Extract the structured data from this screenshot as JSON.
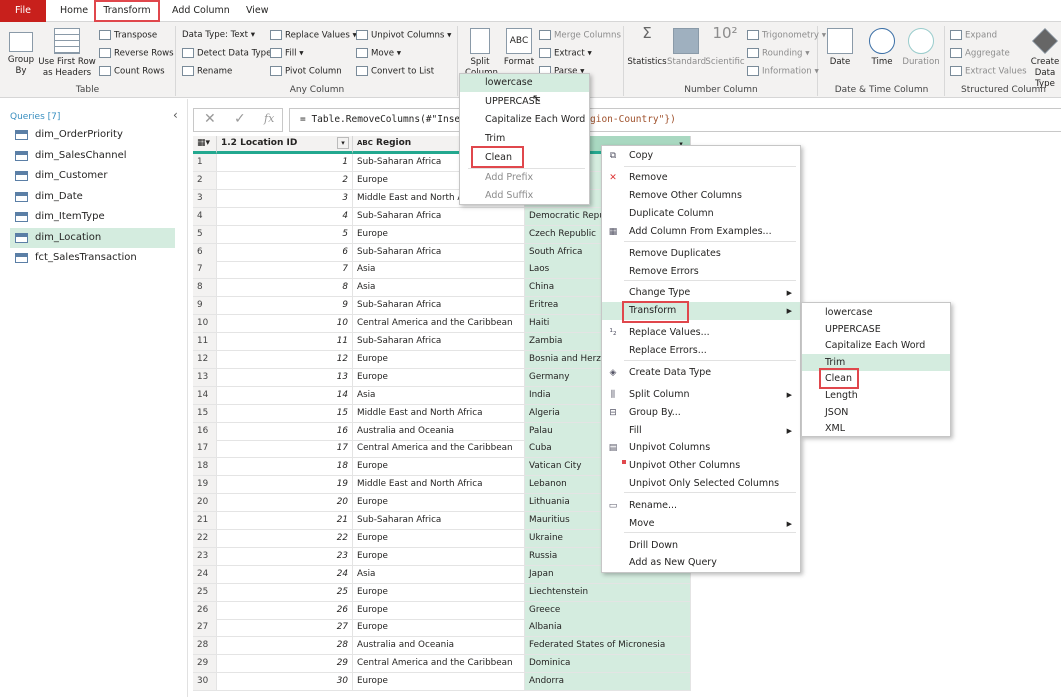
{
  "tabs": [
    "File",
    "Home",
    "Transform",
    "Add Column",
    "View"
  ],
  "ribbon": {
    "table": {
      "label": "Table",
      "group_by": "Group By",
      "first_row": "Use First Row as Headers",
      "transpose": "Transpose",
      "reverse": "Reverse Rows",
      "count": "Count Rows"
    },
    "any": {
      "label": "Any Column",
      "data_type": "Data Type: Text",
      "detect": "Detect Data Type",
      "rename": "Rename",
      "replace": "Replace Values",
      "fill": "Fill",
      "pivot": "Pivot Column",
      "unpivot": "Unpivot Columns",
      "move": "Move",
      "convert": "Convert to List"
    },
    "text": {
      "split": "Split Column",
      "format": "Format",
      "merge": "Merge Columns",
      "extract": "Extract",
      "parse": "Parse"
    },
    "number": {
      "label": "Number Column",
      "statistics": "Statistics",
      "standard": "Standard",
      "scientific": "Scientific",
      "trig": "Trigonometry",
      "rounding": "Rounding",
      "information": "Information"
    },
    "datetime": {
      "label": "Date & Time Column",
      "date": "Date",
      "time": "Time",
      "duration": "Duration"
    },
    "structured": {
      "label": "Structured Column",
      "expand": "Expand",
      "aggregate": "Aggregate",
      "extract_values": "Extract Values",
      "create": "Create Data Type"
    }
  },
  "queries": {
    "header": "Queries [7]",
    "items": [
      "dim_OrderPriority",
      "dim_SalesChannel",
      "dim_Customer",
      "dim_Date",
      "dim_ItemType",
      "dim_Location",
      "fct_SalesTransaction"
    ],
    "selected": "dim_Location"
  },
  "formula": {
    "text": "= Table.RemoveColumns(#\"Inser",
    "tail": "gion-Country\"})"
  },
  "columns": [
    {
      "type": "1.2",
      "name": "Location ID"
    },
    {
      "type": "ABC",
      "name": "Region"
    }
  ],
  "rows": [
    [
      1,
      "Sub-Saharan Africa",
      ""
    ],
    [
      2,
      "Europe",
      ""
    ],
    [
      3,
      "Middle East and North Africa",
      ""
    ],
    [
      4,
      "Sub-Saharan Africa",
      "Democratic Republic of the Congo"
    ],
    [
      5,
      "Europe",
      "Czech Republic"
    ],
    [
      6,
      "Sub-Saharan Africa",
      "South Africa"
    ],
    [
      7,
      "Asia",
      "Laos"
    ],
    [
      8,
      "Asia",
      "China"
    ],
    [
      9,
      "Sub-Saharan Africa",
      "Eritrea"
    ],
    [
      10,
      "Central America and the Caribbean",
      "Haiti"
    ],
    [
      11,
      "Sub-Saharan Africa",
      "Zambia"
    ],
    [
      12,
      "Europe",
      "Bosnia and Herzegovina"
    ],
    [
      13,
      "Europe",
      "Germany"
    ],
    [
      14,
      "Asia",
      "India"
    ],
    [
      15,
      "Middle East and North Africa",
      "Algeria"
    ],
    [
      16,
      "Australia and Oceania",
      "Palau"
    ],
    [
      17,
      "Central America and the Caribbean",
      "Cuba"
    ],
    [
      18,
      "Europe",
      "Vatican City"
    ],
    [
      19,
      "Middle East and North Africa",
      "Lebanon"
    ],
    [
      20,
      "Europe",
      "Lithuania"
    ],
    [
      21,
      "Sub-Saharan Africa",
      "Mauritius"
    ],
    [
      22,
      "Europe",
      "Ukraine"
    ],
    [
      23,
      "Europe",
      "Russia"
    ],
    [
      24,
      "Asia",
      "Japan"
    ],
    [
      25,
      "Europe",
      "Liechtenstein"
    ],
    [
      26,
      "Europe",
      "Greece"
    ],
    [
      27,
      "Europe",
      "Albania"
    ],
    [
      28,
      "Australia and Oceania",
      "Federated States of Micronesia"
    ],
    [
      29,
      "Central America and the Caribbean",
      "Dominica"
    ],
    [
      30,
      "Europe",
      "Andorra"
    ]
  ],
  "format_menu": [
    "lowercase",
    "UPPERCASE",
    "Capitalize Each Word",
    "Trim",
    "Clean",
    "Add Prefix",
    "Add Suffix"
  ],
  "context_menu": [
    "Copy",
    "Remove",
    "Remove Other Columns",
    "Duplicate Column",
    "Add Column From Examples...",
    "Remove Duplicates",
    "Remove Errors",
    "Change Type",
    "Transform",
    "Replace Values...",
    "Replace Errors...",
    "Create Data Type",
    "Split Column",
    "Group By...",
    "Fill",
    "Unpivot Columns",
    "Unpivot Other Columns",
    "Unpivot Only Selected Columns",
    "Rename...",
    "Move",
    "Drill Down",
    "Add as New Query"
  ],
  "transform_submenu": [
    "lowercase",
    "UPPERCASE",
    "Capitalize Each Word",
    "Trim",
    "Clean",
    "Length",
    "JSON",
    "XML"
  ],
  "colors": {
    "file": "#c8201c",
    "highlight": "#d4ecdf",
    "callout": "#e0474c",
    "accent": "#23a88f"
  }
}
